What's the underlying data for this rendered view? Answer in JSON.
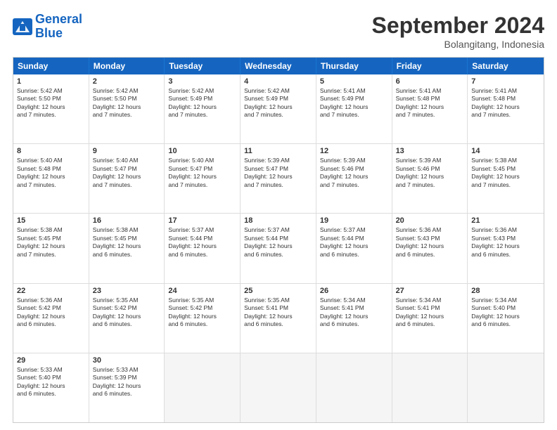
{
  "logo": {
    "line1": "General",
    "line2": "Blue"
  },
  "title": "September 2024",
  "location": "Bolangitang, Indonesia",
  "days": [
    "Sunday",
    "Monday",
    "Tuesday",
    "Wednesday",
    "Thursday",
    "Friday",
    "Saturday"
  ],
  "rows": [
    [
      {
        "day": "1",
        "text": "Sunrise: 5:42 AM\nSunset: 5:50 PM\nDaylight: 12 hours\nand 7 minutes."
      },
      {
        "day": "2",
        "text": "Sunrise: 5:42 AM\nSunset: 5:50 PM\nDaylight: 12 hours\nand 7 minutes."
      },
      {
        "day": "3",
        "text": "Sunrise: 5:42 AM\nSunset: 5:49 PM\nDaylight: 12 hours\nand 7 minutes."
      },
      {
        "day": "4",
        "text": "Sunrise: 5:42 AM\nSunset: 5:49 PM\nDaylight: 12 hours\nand 7 minutes."
      },
      {
        "day": "5",
        "text": "Sunrise: 5:41 AM\nSunset: 5:49 PM\nDaylight: 12 hours\nand 7 minutes."
      },
      {
        "day": "6",
        "text": "Sunrise: 5:41 AM\nSunset: 5:48 PM\nDaylight: 12 hours\nand 7 minutes."
      },
      {
        "day": "7",
        "text": "Sunrise: 5:41 AM\nSunset: 5:48 PM\nDaylight: 12 hours\nand 7 minutes."
      }
    ],
    [
      {
        "day": "8",
        "text": "Sunrise: 5:40 AM\nSunset: 5:48 PM\nDaylight: 12 hours\nand 7 minutes."
      },
      {
        "day": "9",
        "text": "Sunrise: 5:40 AM\nSunset: 5:47 PM\nDaylight: 12 hours\nand 7 minutes."
      },
      {
        "day": "10",
        "text": "Sunrise: 5:40 AM\nSunset: 5:47 PM\nDaylight: 12 hours\nand 7 minutes."
      },
      {
        "day": "11",
        "text": "Sunrise: 5:39 AM\nSunset: 5:47 PM\nDaylight: 12 hours\nand 7 minutes."
      },
      {
        "day": "12",
        "text": "Sunrise: 5:39 AM\nSunset: 5:46 PM\nDaylight: 12 hours\nand 7 minutes."
      },
      {
        "day": "13",
        "text": "Sunrise: 5:39 AM\nSunset: 5:46 PM\nDaylight: 12 hours\nand 7 minutes."
      },
      {
        "day": "14",
        "text": "Sunrise: 5:38 AM\nSunset: 5:45 PM\nDaylight: 12 hours\nand 7 minutes."
      }
    ],
    [
      {
        "day": "15",
        "text": "Sunrise: 5:38 AM\nSunset: 5:45 PM\nDaylight: 12 hours\nand 7 minutes."
      },
      {
        "day": "16",
        "text": "Sunrise: 5:38 AM\nSunset: 5:45 PM\nDaylight: 12 hours\nand 6 minutes."
      },
      {
        "day": "17",
        "text": "Sunrise: 5:37 AM\nSunset: 5:44 PM\nDaylight: 12 hours\nand 6 minutes."
      },
      {
        "day": "18",
        "text": "Sunrise: 5:37 AM\nSunset: 5:44 PM\nDaylight: 12 hours\nand 6 minutes."
      },
      {
        "day": "19",
        "text": "Sunrise: 5:37 AM\nSunset: 5:44 PM\nDaylight: 12 hours\nand 6 minutes."
      },
      {
        "day": "20",
        "text": "Sunrise: 5:36 AM\nSunset: 5:43 PM\nDaylight: 12 hours\nand 6 minutes."
      },
      {
        "day": "21",
        "text": "Sunrise: 5:36 AM\nSunset: 5:43 PM\nDaylight: 12 hours\nand 6 minutes."
      }
    ],
    [
      {
        "day": "22",
        "text": "Sunrise: 5:36 AM\nSunset: 5:42 PM\nDaylight: 12 hours\nand 6 minutes."
      },
      {
        "day": "23",
        "text": "Sunrise: 5:35 AM\nSunset: 5:42 PM\nDaylight: 12 hours\nand 6 minutes."
      },
      {
        "day": "24",
        "text": "Sunrise: 5:35 AM\nSunset: 5:42 PM\nDaylight: 12 hours\nand 6 minutes."
      },
      {
        "day": "25",
        "text": "Sunrise: 5:35 AM\nSunset: 5:41 PM\nDaylight: 12 hours\nand 6 minutes."
      },
      {
        "day": "26",
        "text": "Sunrise: 5:34 AM\nSunset: 5:41 PM\nDaylight: 12 hours\nand 6 minutes."
      },
      {
        "day": "27",
        "text": "Sunrise: 5:34 AM\nSunset: 5:41 PM\nDaylight: 12 hours\nand 6 minutes."
      },
      {
        "day": "28",
        "text": "Sunrise: 5:34 AM\nSunset: 5:40 PM\nDaylight: 12 hours\nand 6 minutes."
      }
    ],
    [
      {
        "day": "29",
        "text": "Sunrise: 5:33 AM\nSunset: 5:40 PM\nDaylight: 12 hours\nand 6 minutes."
      },
      {
        "day": "30",
        "text": "Sunrise: 5:33 AM\nSunset: 5:39 PM\nDaylight: 12 hours\nand 6 minutes."
      },
      {
        "day": "",
        "text": ""
      },
      {
        "day": "",
        "text": ""
      },
      {
        "day": "",
        "text": ""
      },
      {
        "day": "",
        "text": ""
      },
      {
        "day": "",
        "text": ""
      }
    ]
  ]
}
